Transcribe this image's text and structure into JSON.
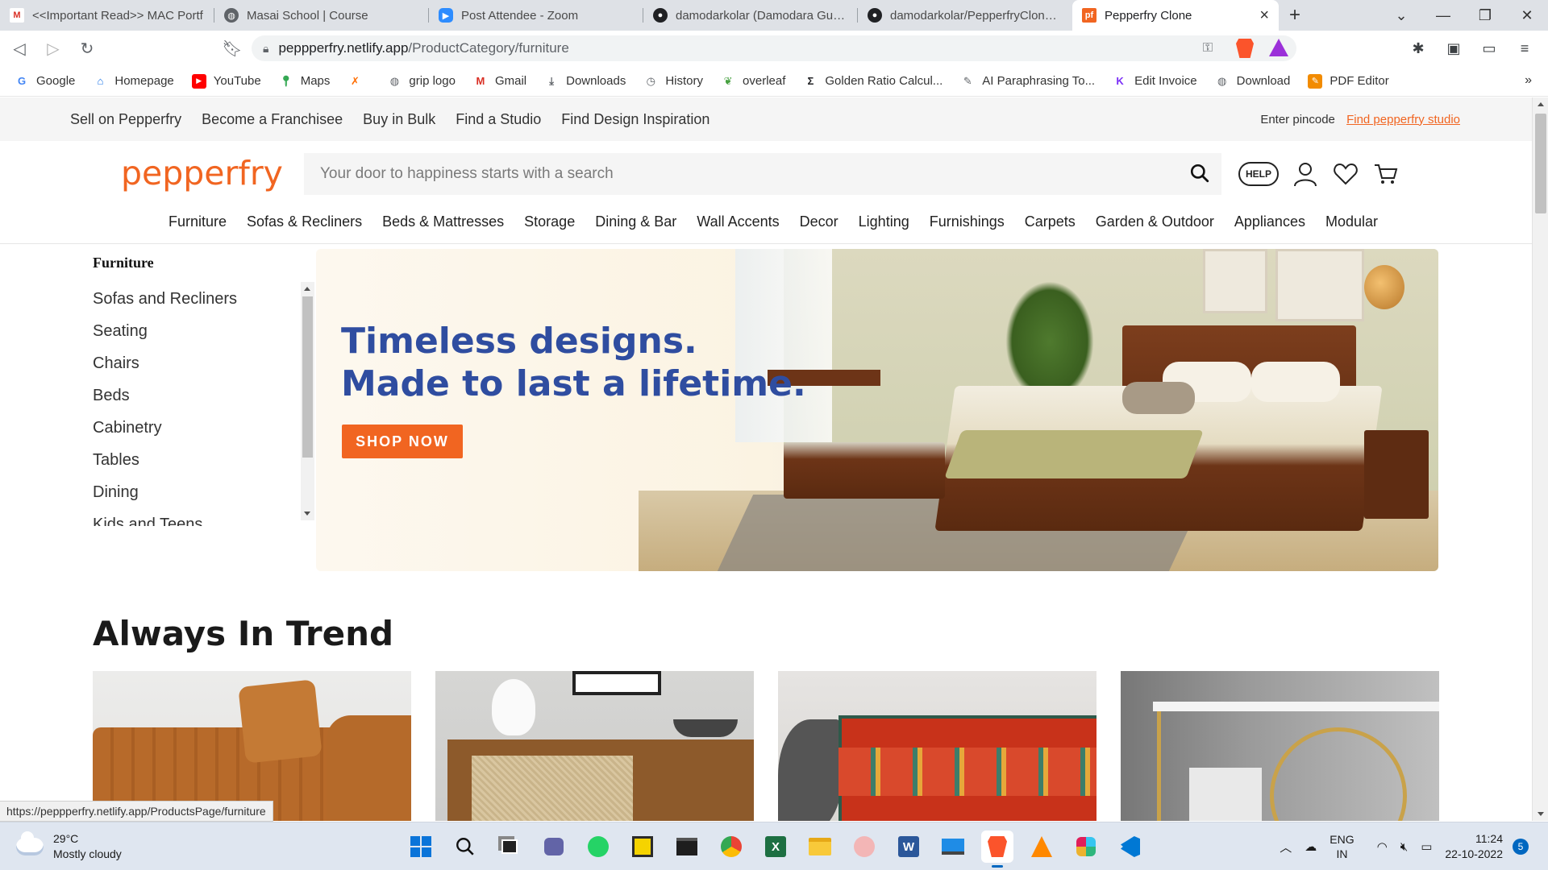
{
  "browser": {
    "tabs": [
      {
        "title": "<<Important Read>> MAC Portf",
        "favicon": "gmail-icon",
        "color": "#d93025",
        "active": false
      },
      {
        "title": "Masai School | Course",
        "favicon": "globe-icon",
        "color": "#5f6368",
        "active": false
      },
      {
        "title": "Post Attendee - Zoom",
        "favicon": "zoom-icon",
        "color": "#2d8cff",
        "active": false
      },
      {
        "title": "damodarkolar (Damodara Gupta",
        "favicon": "github-icon",
        "color": "#202124",
        "active": false
      },
      {
        "title": "damodarkolar/PepperfryClone: C",
        "favicon": "github-icon",
        "color": "#202124",
        "active": false
      },
      {
        "title": "Pepperfry Clone",
        "favicon": "pepperfry-icon",
        "color": "#f16521",
        "active": true
      }
    ],
    "tab_close": "×",
    "new_tab": "+",
    "url_host": "peppperfry.netlify.app",
    "url_path": "/ProductCategory/furniture",
    "bookmarks": [
      {
        "label": "Google",
        "icon": "google-icon",
        "color": "#4285f4"
      },
      {
        "label": "Homepage",
        "icon": "homepage-icon",
        "color": "#1a73e8"
      },
      {
        "label": "YouTube",
        "icon": "youtube-icon",
        "color": "#ff0000"
      },
      {
        "label": "Maps",
        "icon": "maps-icon",
        "color": "#34a853"
      },
      {
        "label": "",
        "icon": "pinwheel-icon",
        "color": "#ff6d00"
      },
      {
        "label": "grip logo",
        "icon": "globe-icon",
        "color": "#5f6368"
      },
      {
        "label": "Gmail",
        "icon": "gmail-icon",
        "color": "#d93025"
      },
      {
        "label": "Downloads",
        "icon": "download-icon",
        "color": "#5f6368"
      },
      {
        "label": "History",
        "icon": "history-icon",
        "color": "#5f6368"
      },
      {
        "label": "overleaf",
        "icon": "overleaf-icon",
        "color": "#47a141"
      },
      {
        "label": "Golden Ratio Calcul...",
        "icon": "sigma-icon",
        "color": "#202124"
      },
      {
        "label": "AI Paraphrasing To...",
        "icon": "pen-icon",
        "color": "#5f6368"
      },
      {
        "label": "Edit Invoice",
        "icon": "invoice-icon",
        "color": "#7b2ff7"
      },
      {
        "label": "Download",
        "icon": "globe-icon",
        "color": "#5f6368"
      },
      {
        "label": "PDF Editor",
        "icon": "pdf-icon",
        "color": "#f28b00"
      }
    ]
  },
  "site": {
    "top_links": [
      "Sell on Pepperfry",
      "Become a Franchisee",
      "Buy in Bulk",
      "Find a Studio",
      "Find Design Inspiration"
    ],
    "pincode_label": "Enter pincode",
    "studio_link": "Find pepperfry studio",
    "logo": "pepperfry",
    "search_placeholder": "Your door to happiness starts with a search",
    "help_label": "HELP",
    "categories": [
      "Furniture",
      "Sofas & Recliners",
      "Beds & Mattresses",
      "Storage",
      "Dining & Bar",
      "Wall Accents",
      "Decor",
      "Lighting",
      "Furnishings",
      "Carpets",
      "Garden & Outdoor",
      "Appliances",
      "Modular"
    ],
    "sidebar_title": "Furniture",
    "sidebar_items": [
      "Sofas and Recliners",
      "Seating",
      "Chairs",
      "Beds",
      "Cabinetry",
      "Tables",
      "Dining",
      "Kids and Teens"
    ],
    "banner_line1": "Timeless designs.",
    "banner_line2": "Made to last a lifetime.",
    "banner_cta": "SHOP NOW",
    "trend_title": "Always In Trend",
    "status_url": "https://peppperfry.netlify.app/ProductsPage/furniture",
    "accent_color": "#f16521"
  },
  "taskbar": {
    "temperature": "29°C",
    "weather": "Mostly cloudy",
    "lang": "ENG",
    "region": "IN",
    "time": "11:24",
    "date": "22-10-2022",
    "notifications": "5"
  }
}
